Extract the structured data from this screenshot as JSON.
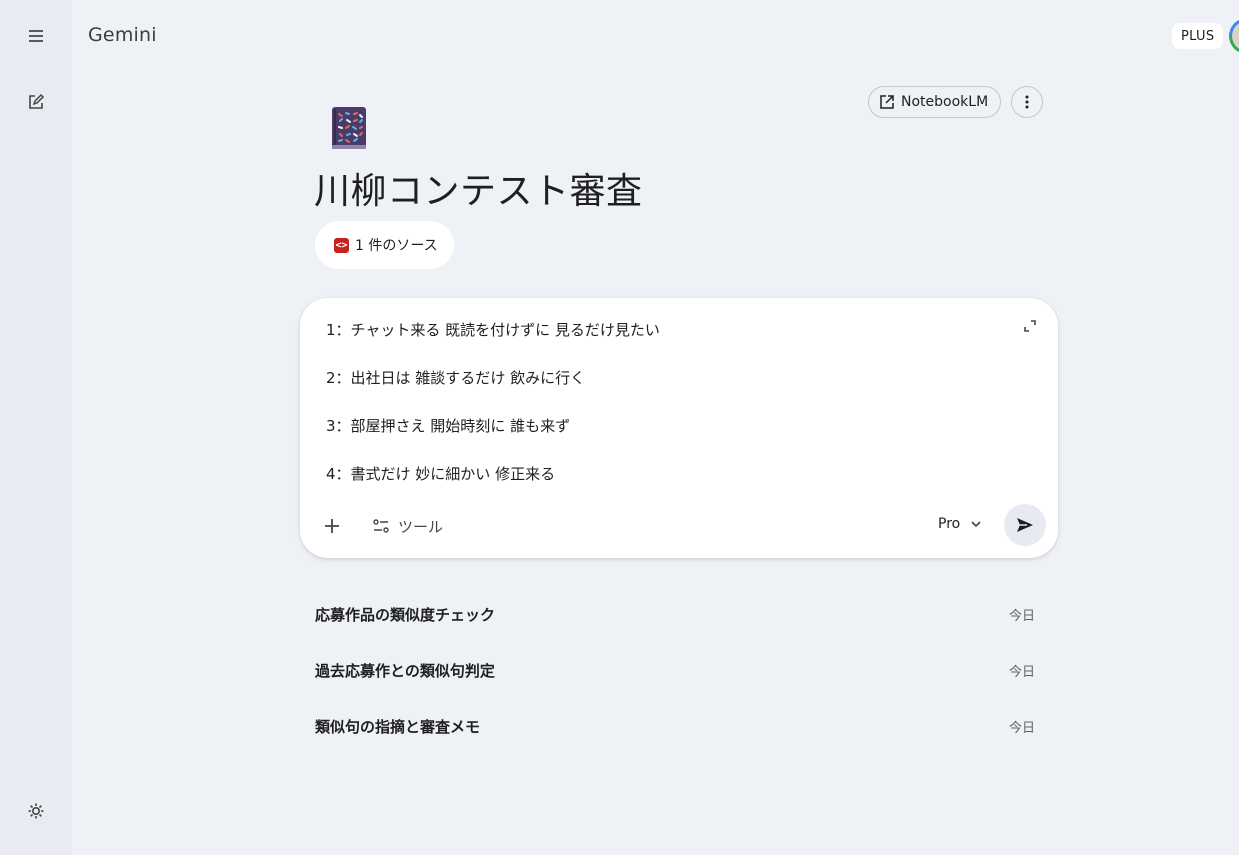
{
  "app": {
    "title": "Gemini",
    "plan_badge": "PLUS"
  },
  "rail": {
    "menu_icon": "menu-icon",
    "new_chat_icon": "edit-icon",
    "settings_icon": "gear-icon"
  },
  "header_actions": {
    "notebooklm_label": "NotebookLM",
    "more_icon": "more-vert-icon"
  },
  "gem": {
    "icon": "notebook-icon",
    "title": "川柳コンテスト審査",
    "source_chip_label": "1 件のソース"
  },
  "prompt": {
    "lines": [
      "1：チャット来る 既読を付けずに 見るだけ見たい",
      "2：出社日は 雑談するだけ 飲みに行く",
      "3：部屋押さえ 開始時刻に 誰も来ず",
      "4：書式だけ 妙に細かい 修正来る"
    ],
    "tools_label": "ツール",
    "model_label": "Pro",
    "accent_color": "#1f1f1f"
  },
  "chats": [
    {
      "title": "応募作品の類似度チェック",
      "time": "今日"
    },
    {
      "title": "過去応募作との類似句判定",
      "time": "今日"
    },
    {
      "title": "類似句の指摘と審査メモ",
      "time": "今日"
    }
  ]
}
